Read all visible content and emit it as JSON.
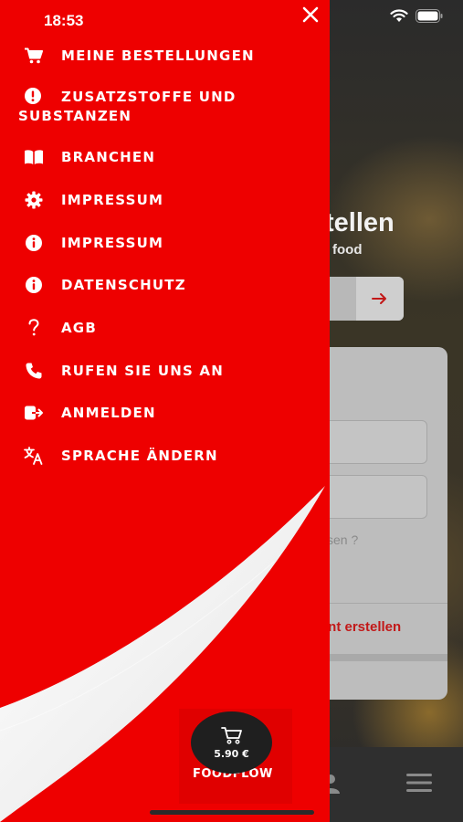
{
  "status_bar": {
    "time": "18:53"
  },
  "menu": {
    "items": [
      {
        "label": "MEINE BESTELLUNGEN",
        "icon": "cart-icon"
      },
      {
        "label": "ZUSATZSTOFFE UND SUBSTANZEN",
        "icon": "alert-circle-icon"
      },
      {
        "label": "BRANCHEN",
        "icon": "book-icon"
      },
      {
        "label": "IMPRESSUM",
        "icon": "gear-icon"
      },
      {
        "label": "IMPRESSUM",
        "icon": "info-icon"
      },
      {
        "label": "DATENSCHUTZ",
        "icon": "info-icon"
      },
      {
        "label": "AGB",
        "icon": "question-icon"
      },
      {
        "label": "RUFEN SIE UNS AN",
        "icon": "phone-icon"
      },
      {
        "label": "ANMELDEN",
        "icon": "login-icon"
      },
      {
        "label": "SPRACHE ÄNDERN",
        "icon": "translate-icon"
      }
    ]
  },
  "brand": {
    "name": "FOODFLOW"
  },
  "cart": {
    "price": "5.90 €"
  },
  "background": {
    "title": "tellen",
    "subtitle": "food",
    "forgot_text": "sen ?",
    "register_text": "unt erstellen"
  },
  "colors": {
    "drawer_red": "#ee0000",
    "text_white": "#ffffff",
    "cart_dark": "#1f1f1f",
    "accent_red": "#c21818"
  }
}
